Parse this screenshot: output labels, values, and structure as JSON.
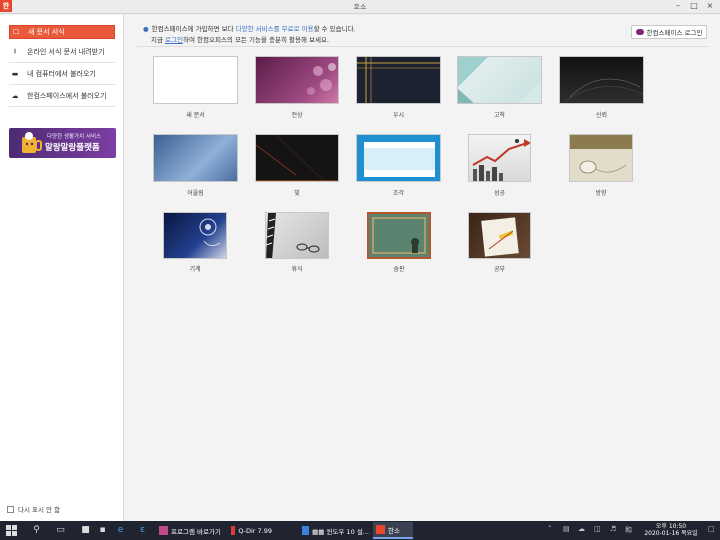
{
  "window": {
    "app_logo": "한",
    "title": "호소",
    "minimize": "–",
    "maximize": "□",
    "close": "×"
  },
  "sidebar": {
    "items": [
      {
        "label": "새 문서 서식",
        "icon": "☐"
      },
      {
        "label": "온라인 서식 문서 내려받기",
        "icon": "⭳"
      },
      {
        "label": "내 컴퓨터에서 불러오기",
        "icon": "▬"
      },
      {
        "label": "한컴스페이스에서 불러오기",
        "icon": "☁"
      }
    ],
    "banner": {
      "small": "다양한 생활가치 서비스",
      "big": "말랑말랑플랫폼"
    },
    "dont_show": "다시 표시 안 함"
  },
  "notice": {
    "line1_a": "한컴스페이스에 가입하면 보다 ",
    "line1_hl": "다양한 서비스를 무료로 이용",
    "line1_b": "할 수 있습니다.",
    "line2_a": "지금 ",
    "line2_link": "로그인",
    "line2_b": "하여 한컴오피스의 모든 기능을 충분히 활용해 보세요.",
    "login_button": "한컴스페이스 로그인"
  },
  "templates": [
    {
      "name": "새 문서",
      "bg": "#ffffff"
    },
    {
      "name": "전상",
      "bg": "linear-gradient(135deg, #5a1d47, #a04b84 70%, #d07aa9)"
    },
    {
      "name": "우시",
      "bg": "#1c2230"
    },
    {
      "name": "고착",
      "bg": "linear-gradient(135deg, #e9f2f2, #c8e0e0)"
    },
    {
      "name": "신뢰",
      "bg": "linear-gradient(180deg, #111, #2e2e2e)"
    },
    {
      "name": "어울림",
      "bg": "linear-gradient(135deg, #3b5f92, #8fb0d6 60%, #4a6ea3)"
    },
    {
      "name": "빛",
      "bg": "#141414"
    },
    {
      "name": "조각",
      "bg": "#ffffff"
    },
    {
      "name": "성공",
      "bg": "linear-gradient(180deg, #f4f4f4, #d9d9d9)"
    },
    {
      "name": "방향",
      "bg": "linear-gradient(180deg, #8c7b4e 30%, #e2dccb 30%)"
    },
    {
      "name": "기계",
      "bg": "linear-gradient(135deg, #0a1640, #23408e 60%, #cfd6e8)"
    },
    {
      "name": "휴식",
      "bg": "linear-gradient(135deg, #e6e6e6, #bdbdbd)"
    },
    {
      "name": "숨판",
      "bg": "#5b8470"
    },
    {
      "name": "공부",
      "bg": "linear-gradient(135deg, #3a2417, #6a4a33)"
    }
  ],
  "taskbar": {
    "apps": [
      {
        "label": "프로그램 바로가기",
        "color": "#c24a8b"
      },
      {
        "label": "Q-Dir 7.99",
        "color": "#e03a3a"
      },
      {
        "label": "▦▦ 윈도우 10 설...",
        "color": "#3b82e0"
      },
      {
        "label": "한소",
        "color": "#e8472e"
      }
    ],
    "clock_line1": "오후 10:50",
    "clock_line2": "2020-01-16 목요일"
  }
}
